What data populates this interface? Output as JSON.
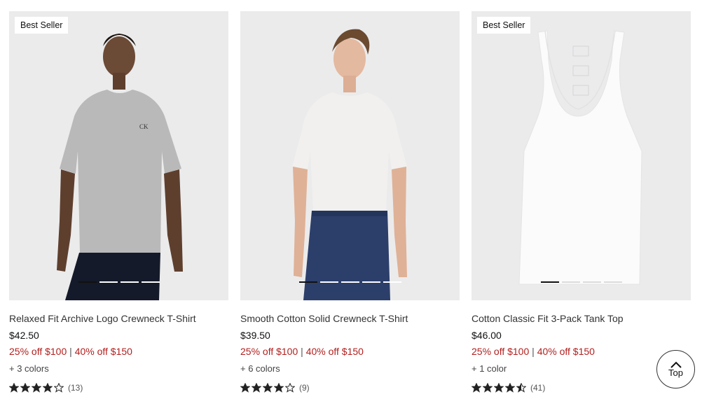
{
  "products": [
    {
      "badge": "Best Seller",
      "name": "Relaxed Fit Archive Logo Crewneck T-Shirt",
      "price": "$42.50",
      "promo_a": "25% off $100",
      "promo_sep": "|",
      "promo_b": "40% off $150",
      "colors": "+ 3 colors",
      "rating": 4,
      "review_count": "(13)",
      "carousel_active": 0,
      "carousel_total": 4
    },
    {
      "badge": "",
      "name": "Smooth Cotton Solid Crewneck T-Shirt",
      "price": "$39.50",
      "promo_a": "25% off $100",
      "promo_sep": "|",
      "promo_b": "40% off $150",
      "colors": "+ 6 colors",
      "rating": 4,
      "review_count": "(9)",
      "carousel_active": 0,
      "carousel_total": 5
    },
    {
      "badge": "Best Seller",
      "name": "Cotton Classic Fit 3-Pack Tank Top",
      "price": "$46.00",
      "promo_a": "25% off $100",
      "promo_sep": "|",
      "promo_b": "40% off $150",
      "colors": "+ 1 color",
      "rating": 4.5,
      "review_count": "(41)",
      "carousel_active": 0,
      "carousel_total": 4
    }
  ],
  "top_button": {
    "label": "Top",
    "icon": "chevron-up-icon"
  },
  "colors": {
    "promo": "#b2201f",
    "star": "#222222",
    "image_bg": "#ebebec"
  }
}
